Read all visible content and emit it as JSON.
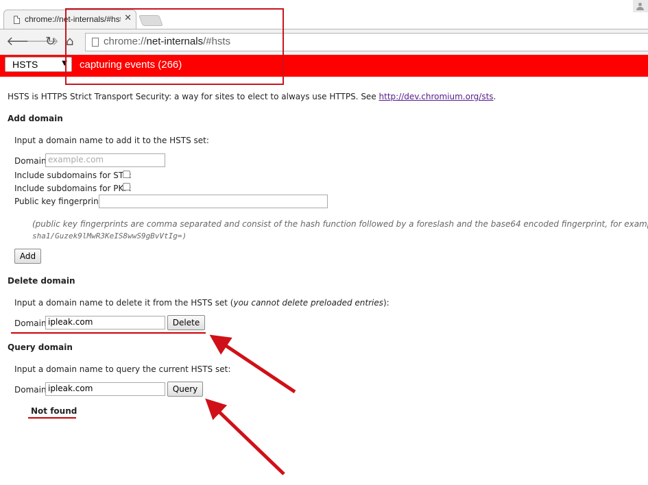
{
  "browser": {
    "tab_title": "chrome://net-internals/#hsts",
    "tab_close": "✕",
    "url_scheme": "chrome://",
    "url_host": "net-internals",
    "url_path": "/#hsts"
  },
  "statusbar": {
    "view": "HSTS",
    "status": "capturing events (266)",
    "color": "#ff0000"
  },
  "intro": {
    "text": "HSTS is HTTPS Strict Transport Security: a way for sites to elect to always use HTTPS. See ",
    "link": "http://dev.chromium.org/sts",
    "suffix": "."
  },
  "add_domain": {
    "heading": "Add domain",
    "description": "Input a domain name to add it to the HSTS set:",
    "domain_label": "Domain:",
    "domain_placeholder": "example.com",
    "sts_label": "Include subdomains for STS:",
    "pkp_label": "Include subdomains for PKP:",
    "fingerprints_label": "Public key fingerprints:",
    "note_line1": "(public key fingerprints are comma separated and consist of the hash function followed by a foreslash and the base64 encoded fingerprint, for example",
    "note_line2": "sha1/Guzek9lMwR3KeIS8wwS9gBvVtIg=)",
    "add_button": "Add"
  },
  "delete_domain": {
    "heading": "Delete domain",
    "description_prefix": "Input a domain name to delete it from the HSTS set (",
    "description_italic": "you cannot delete preloaded entries",
    "description_suffix": "):",
    "domain_label": "Domain:",
    "domain_value": "ipleak.com",
    "delete_button": "Delete"
  },
  "query_domain": {
    "heading": "Query domain",
    "description": "Input a domain name to query the current HSTS set:",
    "domain_label": "Domain:",
    "domain_value": "ipleak.com",
    "query_button": "Query",
    "result": "Not found"
  },
  "annotation_color": "#c8141c"
}
